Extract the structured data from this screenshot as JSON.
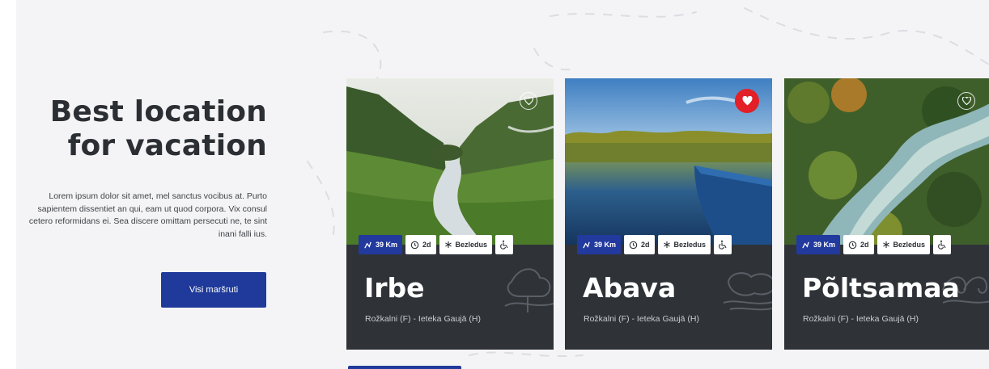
{
  "intro": {
    "title_line1": "Best location",
    "title_line2": "for vacation",
    "text": "Lorem ipsum dolor sit amet, mel sanctus vocibus at. Purto sapientem dissentiet an qui, eam ut quod corpora. Vix consul cetero reformidans ei. Sea discere omittam persecuti ne, te sint inani falli ius.",
    "button_label": "Visi maršruti"
  },
  "cards": [
    {
      "title": "Irbe",
      "route": "Rožkalni (F) - Ieteka Gaujā (H)",
      "favorited": false,
      "image_icon": "mountain-valley-photo",
      "tags": {
        "distance": "39 Km",
        "duration": "2d",
        "season": "Bezledus",
        "accessibility_icon": "wheelchair-icon"
      }
    },
    {
      "title": "Abava",
      "route": "Rožkalni (F) - Ieteka Gaujā (H)",
      "favorited": true,
      "image_icon": "lake-boat-photo",
      "tags": {
        "distance": "39 Km",
        "duration": "2d",
        "season": "Bezledus",
        "accessibility_icon": "wheelchair-icon"
      }
    },
    {
      "title": "Põltsamaa",
      "route": "Rožkalni (F) - Ieteka Gaujā (H)",
      "favorited": false,
      "image_icon": "river-aerial-photo",
      "tags": {
        "distance": "39 Km",
        "duration": "2d",
        "season": "Bezledus",
        "accessibility_icon": "wheelchair-icon"
      }
    }
  ],
  "colors": {
    "primary": "#1f3a9a",
    "favorite": "#e32028",
    "card_bg": "#2f3338",
    "page_bg": "#f4f4f6"
  }
}
